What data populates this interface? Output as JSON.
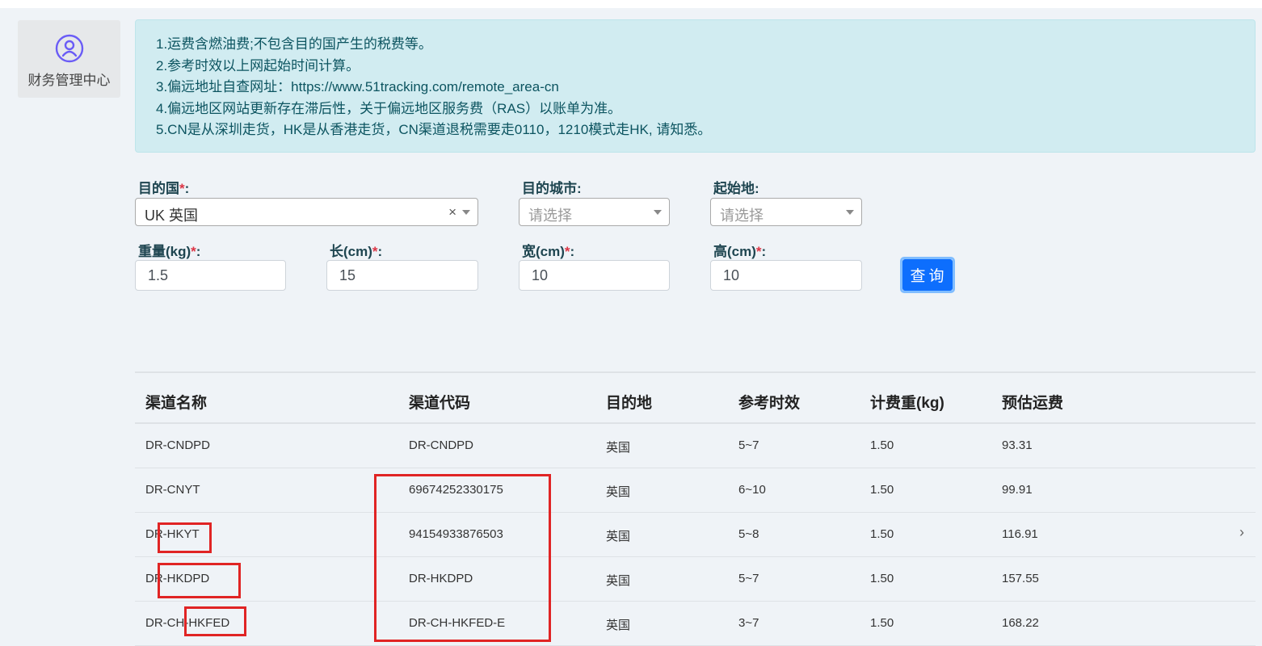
{
  "sidebar": {
    "label": "财务管理中心",
    "icon": "user-circle-icon"
  },
  "notice": {
    "lines": [
      "1.运费含燃油费;不包含目的国产生的税费等。",
      "2.参考时效以上网起始时间计算。",
      "3.偏远地址自查网址：https://www.51tracking.com/remote_area-cn",
      "4.偏远地区网站更新存在滞后性，关于偏远地区服务费（RAS）以账单为准。",
      "5.CN是从深圳走货，HK是从香港走货，CN渠道退税需要走0110，1210模式走HK, 请知悉。"
    ]
  },
  "form": {
    "required_mark": "*",
    "colon": ":",
    "destination": {
      "label": "目的国",
      "value": "UK 英国",
      "clear": "×"
    },
    "city": {
      "label": "目的城市:",
      "placeholder": "请选择"
    },
    "origin": {
      "label": "起始地:",
      "placeholder": "请选择"
    },
    "weight": {
      "label": "重量(kg)",
      "value": "1.5"
    },
    "length": {
      "label": "长(cm)",
      "value": "15"
    },
    "width": {
      "label": "宽(cm)",
      "value": "10"
    },
    "height": {
      "label": "高(cm)",
      "value": "10"
    },
    "query_label": "查询"
  },
  "table": {
    "headers": [
      "渠道名称",
      "渠道代码",
      "目的地",
      "参考时效",
      "计费重(kg)",
      "预估运费"
    ],
    "rows": [
      [
        "DR-CNDPD",
        "DR-CNDPD",
        "英国",
        "5~7",
        "1.50",
        "93.31"
      ],
      [
        "DR-CNYT",
        "69674252330175",
        "英国",
        "6~10",
        "1.50",
        "99.91"
      ],
      [
        "DR-HKYT",
        "94154933876503",
        "英国",
        "5~8",
        "1.50",
        "116.91"
      ],
      [
        "DR-HKDPD",
        "DR-HKDPD",
        "英国",
        "5~7",
        "1.50",
        "157.55"
      ],
      [
        "DR-CH-HKFED",
        "DR-CH-HKFED-E",
        "英国",
        "3~7",
        "1.50",
        "168.22"
      ]
    ],
    "row_arrow": "›"
  },
  "colors": {
    "annotation_red": "#e02424",
    "primary_button": "#0d6efd",
    "notice_bg": "#d1ecf1",
    "required": "#dc3545"
  }
}
